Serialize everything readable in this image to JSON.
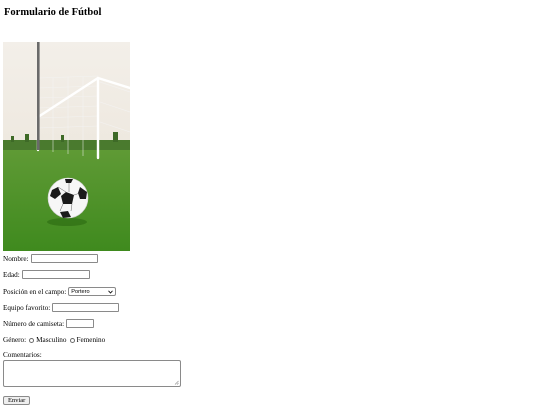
{
  "form": {
    "title": "Formulario de Fútbol",
    "image_alt": "soccer-ball-on-field",
    "fields": {
      "nombre": "Nombre:",
      "edad": "Edad:",
      "posicion": "Posición en el campo:",
      "posicion_selected": "Portero",
      "equipo": "Equipo favorito:",
      "camiseta": "Número de camiseta:",
      "genero": "Género:",
      "masculino": "Masculino",
      "femenino": "Femenino",
      "comentarios": "Comentarios:"
    },
    "submit": "Enviar"
  }
}
